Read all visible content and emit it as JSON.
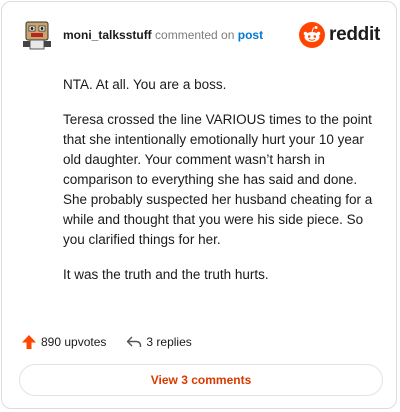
{
  "header": {
    "username": "moni_talksstuff",
    "action_text": "commented on",
    "post_link": "post",
    "brand": "reddit"
  },
  "comment": {
    "paragraphs": [
      "NTA. At all. You are a boss.",
      "Teresa crossed the line VARIOUS times to the point that she intentionally emotionally hurt your 10 year old daughter. Your comment wasn’t harsh in comparison to everything she has said and done. She probably suspected her husband cheating for a while and thought that you were his side piece. So you clarified things for her.",
      "It was the truth and the truth hurts."
    ]
  },
  "footer": {
    "upvotes": "890 upvotes",
    "replies": "3 replies",
    "view_comments": "View 3 comments"
  },
  "colors": {
    "accent": "#ff4500",
    "link": "#0079d3",
    "button_text": "#d93a00"
  }
}
